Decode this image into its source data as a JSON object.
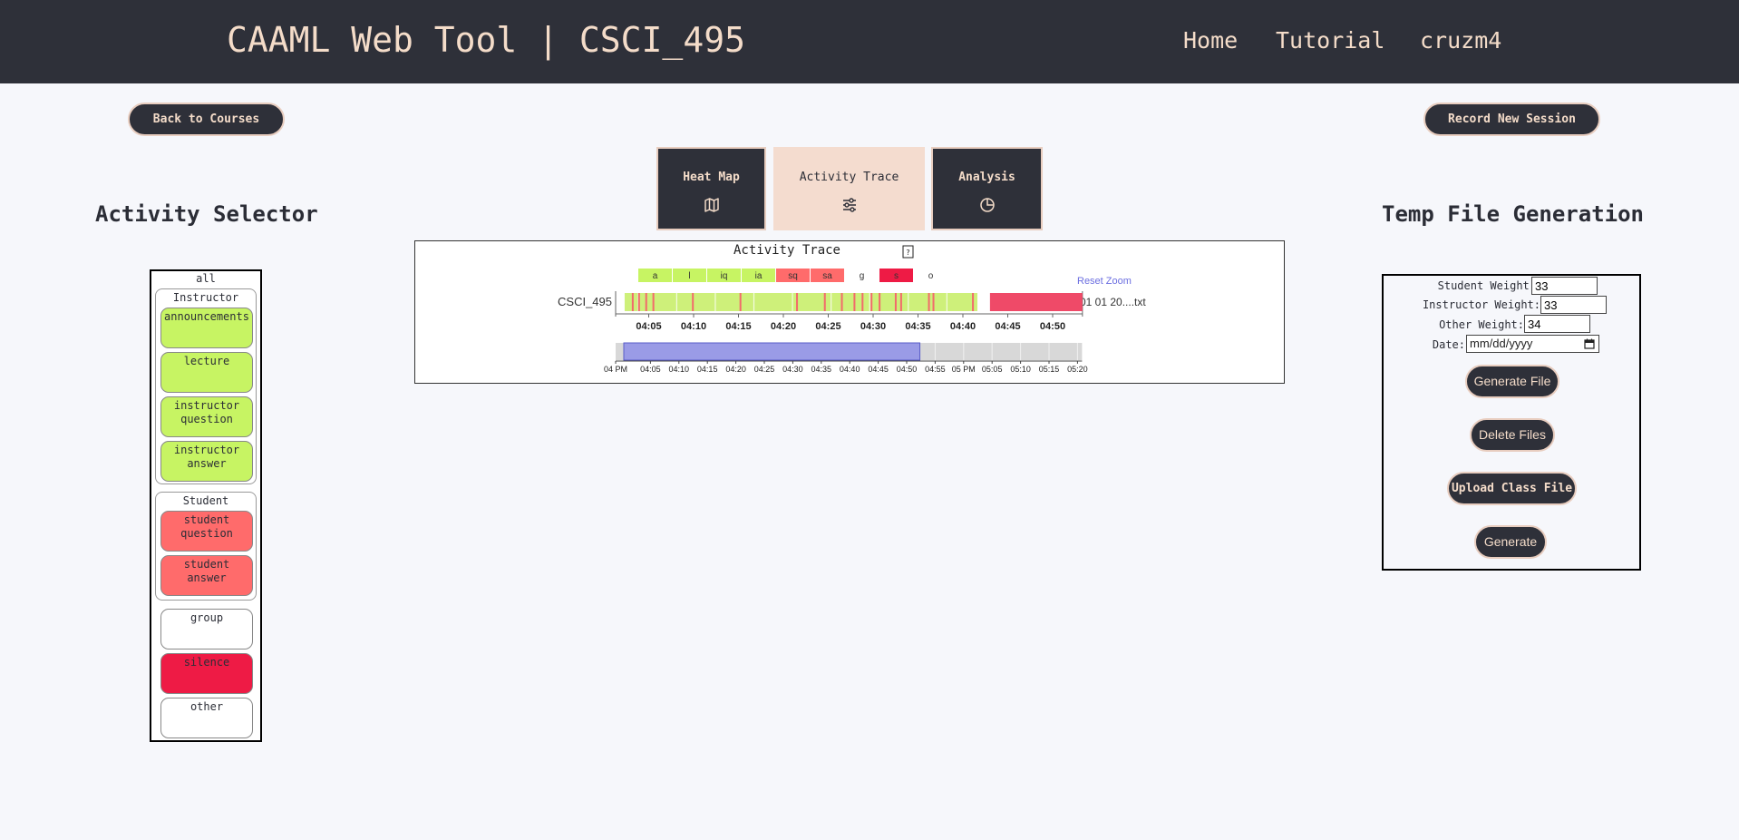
{
  "header": {
    "brand": "CAAML Web Tool | CSCI_495",
    "nav": {
      "home": "Home",
      "tutorial": "Tutorial",
      "user": "cruzm4"
    }
  },
  "actions": {
    "back": "Back to Courses",
    "record": "Record New Session"
  },
  "tabs": [
    {
      "label": "Heat Map",
      "icon": "map-icon",
      "active": false
    },
    {
      "label": "Activity Trace",
      "icon": "sliders-icon",
      "active": true
    },
    {
      "label": "Analysis",
      "icon": "pie-chart-icon",
      "active": false
    }
  ],
  "activity_selector": {
    "title": "Activity Selector",
    "all": "all",
    "instructor": {
      "title": "Instructor",
      "items": [
        "announcements",
        "lecture",
        "instructor question",
        "instructor answer"
      ]
    },
    "student": {
      "title": "Student",
      "items": [
        "student question",
        "student answer"
      ]
    },
    "others": [
      "group",
      "silence",
      "other"
    ]
  },
  "colors": {
    "header_bg": "#2e3039",
    "accent": "#f4dcc9",
    "instructor": "#c7f463",
    "student": "#ff6b6b",
    "silence": "#ee1b45",
    "brush": "#9a9be6"
  },
  "chart_data": {
    "type": "timeline",
    "title": "Activity Trace",
    "help_icon": "question-mark",
    "reset_zoom": "Reset Zoom",
    "legend": [
      {
        "key": "a",
        "color": "#c7f463"
      },
      {
        "key": "l",
        "color": "#c7f463"
      },
      {
        "key": "iq",
        "color": "#c7f463"
      },
      {
        "key": "ia",
        "color": "#c7f463"
      },
      {
        "key": "sq",
        "color": "#ff6b6b"
      },
      {
        "key": "sa",
        "color": "#ff6b6b"
      },
      {
        "key": "g",
        "color": "#ffffff"
      },
      {
        "key": "s",
        "color": "#ee1b45"
      },
      {
        "key": "o",
        "color": "#ffffff"
      }
    ],
    "row_label": "CSCI_495",
    "row_suffix": "01 01 20....txt",
    "x_ticks": [
      "04:05",
      "04:10",
      "04:15",
      "04:20",
      "04:25",
      "04:30",
      "04:35",
      "04:40",
      "04:45",
      "04:50"
    ],
    "segments": [
      {
        "code": "l",
        "start_min": 0.5,
        "end_min": 39.8
      },
      {
        "code": "s",
        "start_min": 41.2,
        "end_min": 51.5
      }
    ],
    "student_marks_min": [
      1.3,
      2.0,
      2.8,
      3.6,
      8.0,
      13.3,
      19.6,
      22.7,
      24.6,
      26.0,
      26.9,
      27.9,
      28.8,
      30.6,
      31.2,
      34.3,
      34.8,
      39.2
    ],
    "brush_ticks": [
      "04 PM",
      "04:05",
      "04:10",
      "04:15",
      "04:20",
      "04:25",
      "04:30",
      "04:35",
      "04:40",
      "04:45",
      "04:50",
      "04:55",
      "05 PM",
      "05:05",
      "05:10",
      "05:15",
      "05:20"
    ],
    "brush_range": [
      "04:01",
      "04:53"
    ]
  },
  "temp_file": {
    "title": "Temp File Generation",
    "student_weight_label": "Student Weight:",
    "student_weight": "33",
    "instructor_weight_label": "Instructor Weight:",
    "instructor_weight": "33",
    "other_weight_label": "Other Weight:",
    "other_weight": "34",
    "date_label": "Date:",
    "date_placeholder": "mm/dd/yyyy",
    "generate_file": "Generate File",
    "delete_files": "Delete Files",
    "upload_class_file": "Upload Class File",
    "generate": "Generate"
  }
}
